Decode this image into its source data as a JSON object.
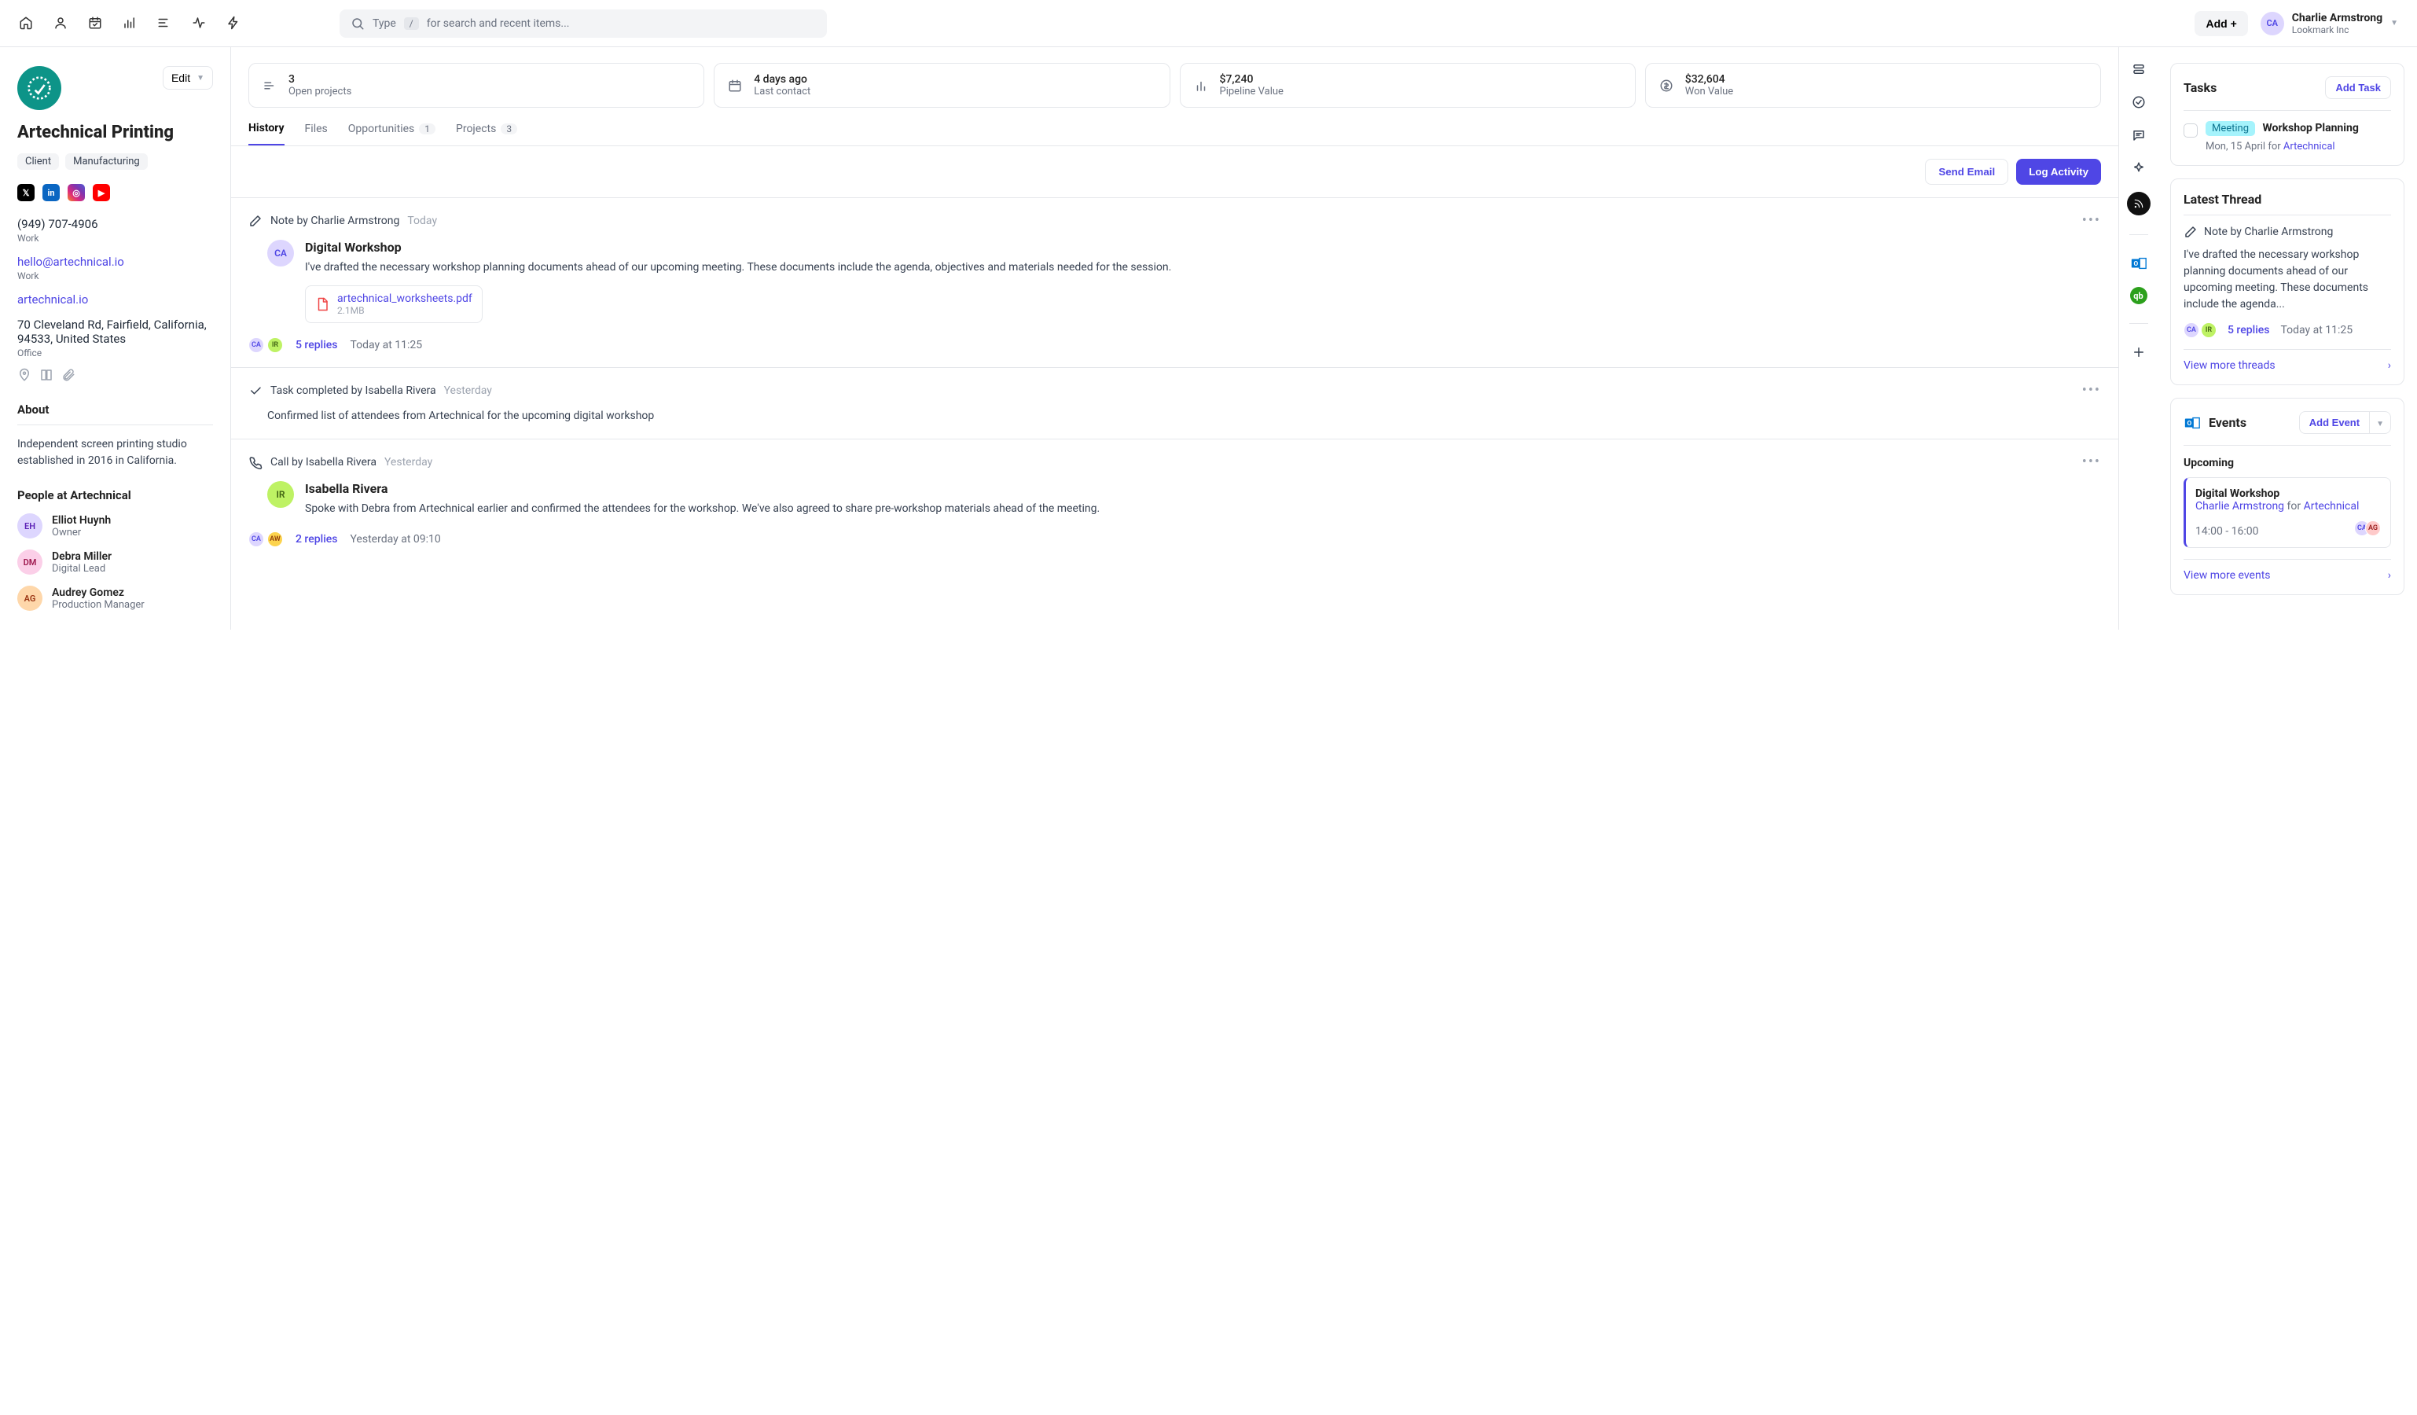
{
  "topbar": {
    "search_placeholder_prefix": "Type",
    "search_kbd": "/",
    "search_placeholder_suffix": "for search and recent items...",
    "add_label": "Add +",
    "user": {
      "initials": "CA",
      "name": "Charlie Armstrong",
      "org": "Lookmark Inc"
    }
  },
  "company": {
    "name": "Artechnical Printing",
    "edit_label": "Edit",
    "tags": [
      "Client",
      "Manufacturing"
    ],
    "phone": "(949) 707-4906",
    "phone_label": "Work",
    "email": "hello@artechnical.io",
    "email_label": "Work",
    "website": "artechnical.io",
    "address": "70 Cleveland Rd, Fairfield, California, 94533, United States",
    "address_label": "Office",
    "about_heading": "About",
    "about_text": "Independent screen printing studio established in 2016 in California.",
    "people_heading": "People at Artechnical",
    "people": [
      {
        "initials": "EH",
        "name": "Elliot Huynh",
        "role": "Owner"
      },
      {
        "initials": "DM",
        "name": "Debra Miller",
        "role": "Digital Lead"
      },
      {
        "initials": "AG",
        "name": "Audrey Gomez",
        "role": "Production Manager"
      }
    ]
  },
  "stats": [
    {
      "value": "3",
      "label": "Open projects"
    },
    {
      "value": "4 days ago",
      "label": "Last contact"
    },
    {
      "value": "$7,240",
      "label": "Pipeline Value"
    },
    {
      "value": "$32,604",
      "label": "Won Value"
    }
  ],
  "tabs": {
    "history": "History",
    "files": "Files",
    "opportunities": "Opportunities",
    "opportunities_count": "1",
    "projects": "Projects",
    "projects_count": "3"
  },
  "actions": {
    "send_email": "Send Email",
    "log_activity": "Log Activity"
  },
  "feed": {
    "note": {
      "label": "Note by Charlie Armstrong",
      "time": "Today",
      "initials": "CA",
      "title": "Digital Workshop",
      "text": "I've drafted the necessary workshop planning documents ahead of our upcoming meeting. These documents include the agenda, objectives and materials needed for the session.",
      "file_name": "artechnical_worksheets.pdf",
      "file_size": "2.1MB",
      "replies": "5 replies",
      "reply_time": "Today at 11:25"
    },
    "task": {
      "label": "Task completed by Isabella Rivera",
      "time": "Yesterday",
      "text": "Confirmed list of attendees from Artechnical for the upcoming digital workshop"
    },
    "call": {
      "label": "Call by Isabella Rivera",
      "time": "Yesterday",
      "initials": "IR",
      "title": "Isabella Rivera",
      "text": "Spoke with Debra from Artechnical earlier and confirmed the attendees for the workshop. We've also agreed to share pre-workshop materials ahead of the meeting.",
      "replies": "2 replies",
      "reply_time": "Yesterday at 09:10"
    }
  },
  "tasks_panel": {
    "title": "Tasks",
    "add_label": "Add Task",
    "tag": "Meeting",
    "task_title": "Workshop Planning",
    "date": "Mon, 15 April",
    "for_word": "for",
    "for_entity": "Artechnical"
  },
  "thread_panel": {
    "title": "Latest Thread",
    "note_label": "Note by Charlie Armstrong",
    "text": "I've drafted the necessary workshop planning documents ahead of our upcoming meeting. These documents include the agenda...",
    "replies": "5 replies",
    "time": "Today at 11:25",
    "view_more": "View more threads"
  },
  "events_panel": {
    "title": "Events",
    "add_label": "Add Event",
    "upcoming_label": "Upcoming",
    "event_title": "Digital Workshop",
    "event_person": "Charlie Armstrong",
    "for_word": "for",
    "for_entity": "Artechnical",
    "time": "14:00 - 16:00",
    "view_more": "View more events"
  }
}
